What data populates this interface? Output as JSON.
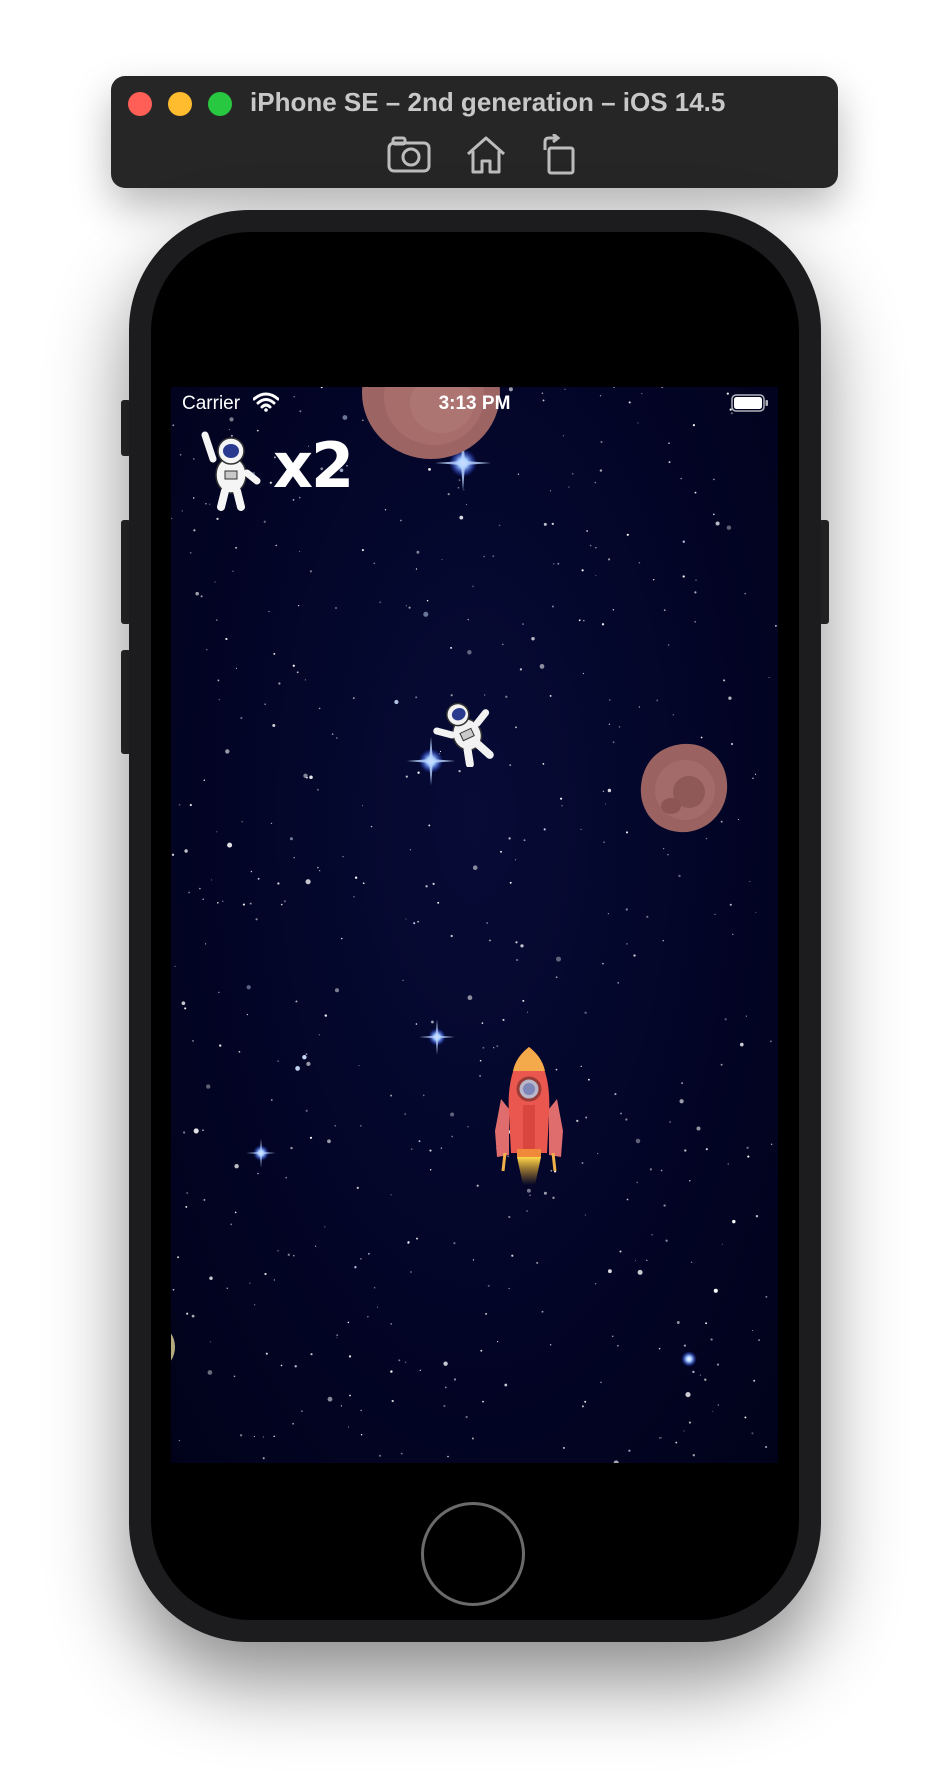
{
  "simulator": {
    "title": "iPhone SE – 2nd generation – iOS 14.5",
    "toolbar": {
      "icons": [
        "camera-icon",
        "home-icon",
        "rotate-icon"
      ]
    },
    "traffic_lights": {
      "close_color": "#ff5f57",
      "minimize_color": "#febc2e",
      "zoom_color": "#28c840"
    }
  },
  "status_bar": {
    "carrier": "Carrier",
    "time": "3:13 PM",
    "icons": [
      "wifi-icon",
      "battery-icon"
    ]
  },
  "game": {
    "lives": {
      "icon": "astronaut-icon",
      "count_text": "x2"
    },
    "background_color": "#030527",
    "sprites": [
      "asteroid",
      "asteroid",
      "astronaut",
      "rocket"
    ]
  }
}
